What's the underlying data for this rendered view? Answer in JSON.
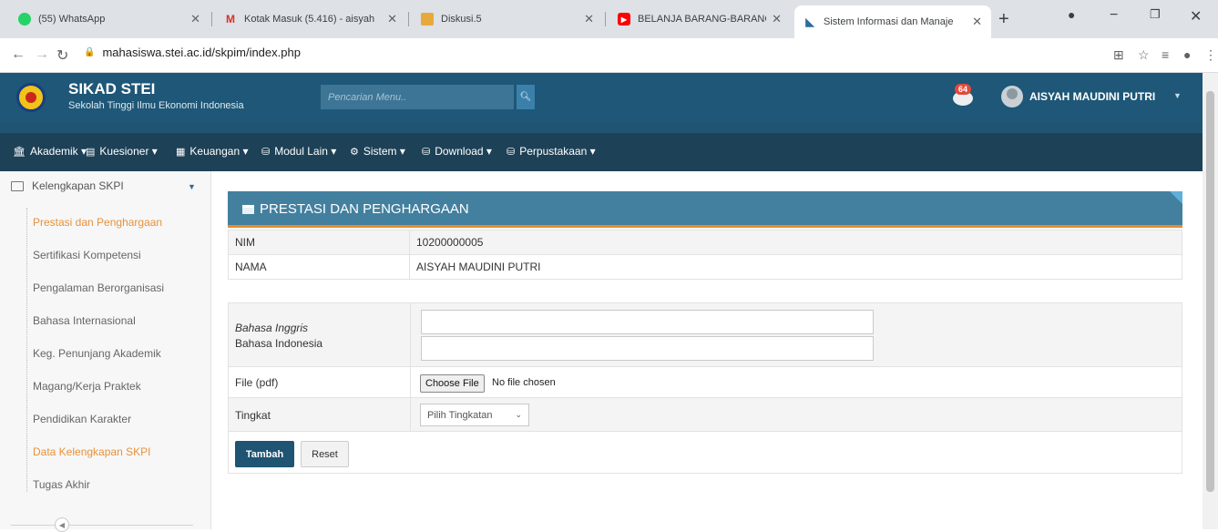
{
  "browser": {
    "tabs": [
      {
        "title": "(55) WhatsApp",
        "favicon": "whatsapp-icon",
        "color": "#25d366"
      },
      {
        "title": "Kotak Masuk (5.416) - aisyah",
        "favicon": "gmail-icon",
        "color": "#d93025"
      },
      {
        "title": "Diskusi.5",
        "favicon": "diskusi-icon",
        "color": "#e8a93b"
      },
      {
        "title": "BELANJA BARANG-BARANG",
        "favicon": "youtube-icon",
        "color": "#ff0000"
      },
      {
        "title": "Sistem Informasi dan Manaje",
        "favicon": "sikad-icon",
        "color": "#2a6da0"
      }
    ],
    "url": "mahasiswa.stei.ac.id/skpim/index.php"
  },
  "header": {
    "brand_name": "SIKAD STEI",
    "brand_sub": "Sekolah Tinggi Ilmu Ekonomi Indonesia",
    "search_placeholder": "Pencarian Menu..",
    "notif_count": "64",
    "username": "AISYAH MAUDINI PUTRI"
  },
  "nav": [
    {
      "label": "Akademik",
      "icon": "bank-icon"
    },
    {
      "label": "Kuesioner",
      "icon": "form-icon"
    },
    {
      "label": "Keuangan",
      "icon": "money-icon"
    },
    {
      "label": "Modul Lain",
      "icon": "database-icon"
    },
    {
      "label": "Sistem",
      "icon": "gear-icon"
    },
    {
      "label": "Download",
      "icon": "database-icon"
    },
    {
      "label": "Perpustakaan",
      "icon": "database-icon"
    }
  ],
  "sidebar": {
    "heading": "Kelengkapan SKPI",
    "items": [
      {
        "label": "Prestasi dan Penghargaan",
        "active": true
      },
      {
        "label": "Sertifikasi Kompetensi",
        "active": false
      },
      {
        "label": "Pengalaman Berorganisasi",
        "active": false
      },
      {
        "label": "Bahasa Internasional",
        "active": false
      },
      {
        "label": "Keg. Penunjang Akademik",
        "active": false
      },
      {
        "label": "Magang/Kerja Praktek",
        "active": false
      },
      {
        "label": "Pendidikan Karakter",
        "active": false
      },
      {
        "label": "Data Kelengkapan SKPI",
        "active": true
      },
      {
        "label": "Tugas Akhir",
        "active": false
      }
    ]
  },
  "panel": {
    "title": "PRESTASI DAN PENGHARGAAN",
    "nim_label": "NIM",
    "nim_value": "10200000005",
    "nama_label": "NAMA",
    "nama_value": "AISYAH MAUDINI PUTRI"
  },
  "form": {
    "label_inggris": "Bahasa Inggris",
    "label_indonesia": "Bahasa Indonesia",
    "value_inggris": "",
    "value_indonesia": "",
    "file_label": "File (pdf)",
    "file_button": "Choose File",
    "file_status": "No file chosen",
    "tingkat_label": "Tingkat",
    "tingkat_selected": "Pilih Tingkatan",
    "submit_label": "Tambah",
    "reset_label": "Reset"
  },
  "colors": {
    "header_bg": "#1e5777",
    "navbar_bg": "#1d4157",
    "panel_head": "#43809f",
    "accent_orange": "#e9913a"
  }
}
